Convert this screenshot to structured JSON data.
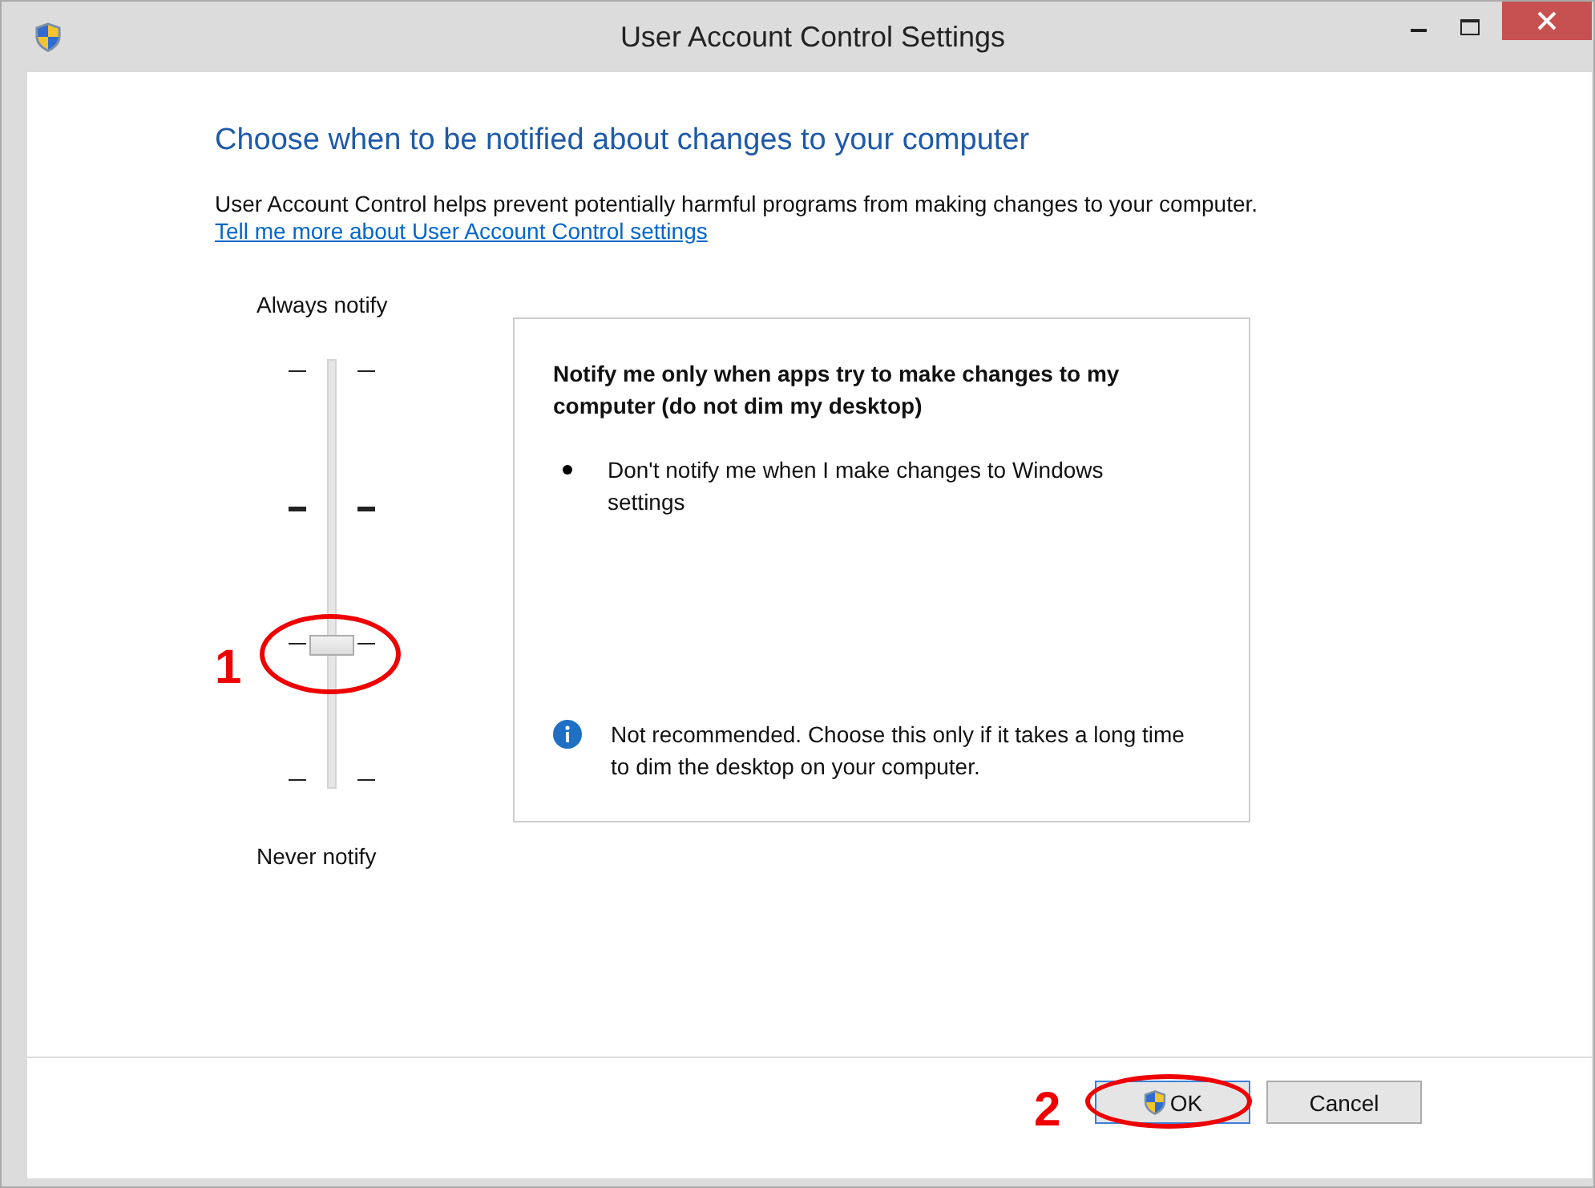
{
  "window": {
    "title": "User Account Control Settings"
  },
  "heading": "Choose when to be notified about changes to your computer",
  "intro": "User Account Control helps prevent potentially harmful programs from making changes to your computer.",
  "help_link": "Tell me more about User Account Control settings",
  "slider": {
    "top_label": "Always notify",
    "bottom_label": "Never notify",
    "level": 0.33,
    "callout": "1"
  },
  "description": {
    "title": "Notify me only when apps try to make changes to my computer (do not dim my desktop)",
    "bullets": [
      "Don't notify me when I make changes to Windows settings"
    ],
    "note": "Not recommended. Choose this only if it takes a long time to dim the desktop on your computer."
  },
  "buttons": [
    {
      "label": "OK",
      "kind": "shield",
      "focused": true,
      "callout": "2"
    },
    {
      "label": "Cancel",
      "kind": "plain",
      "focused": false
    }
  ]
}
